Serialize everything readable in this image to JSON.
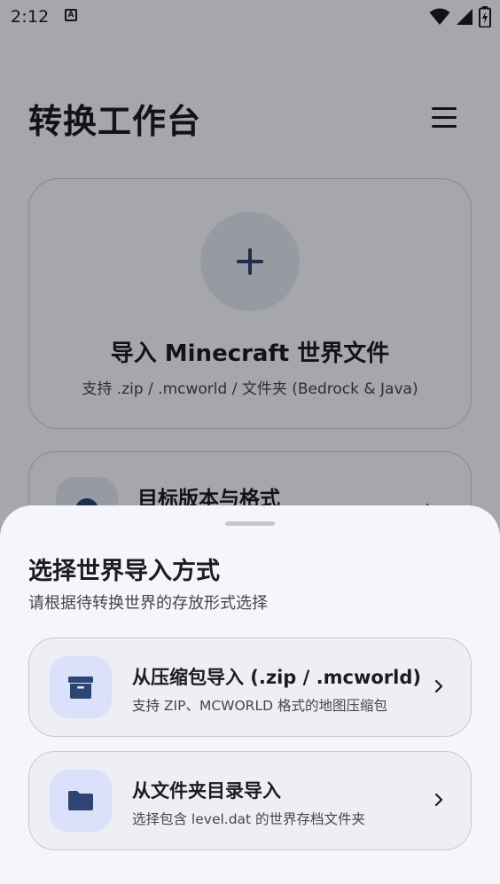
{
  "status_bar": {
    "time": "2:12",
    "a_badge": "A",
    "icons": [
      "wifi-icon",
      "signal-icon",
      "battery-charging-icon"
    ]
  },
  "header": {
    "title": "转换工作台",
    "menu_icon": "menu-icon"
  },
  "import_card": {
    "icon": "plus-icon",
    "title": "导入 Minecraft 世界文件",
    "subtitle": "支持 .zip / .mcworld / 文件夹 (Bedrock & Java)"
  },
  "target_card": {
    "icon": "globe-icon",
    "title": "目标版本与格式",
    "chevron": "›"
  },
  "sheet": {
    "title": "选择世界导入方式",
    "subtitle": "请根据待转换世界的存放形式选择",
    "options": [
      {
        "icon": "archive-icon",
        "title": "从压缩包导入 (.zip / .mcworld)",
        "subtitle": "支持 ZIP、MCWORLD 格式的地图压缩包"
      },
      {
        "icon": "folder-icon",
        "title": "从文件夹目录导入",
        "subtitle": "选择包含 level.dat 的世界存档文件夹"
      }
    ]
  },
  "colors": {
    "accent": "#2d4572",
    "icon_bg": "#dbe1fb",
    "surface": "#f5f6fb",
    "scrim": "rgba(0,0,0,0.32)"
  }
}
